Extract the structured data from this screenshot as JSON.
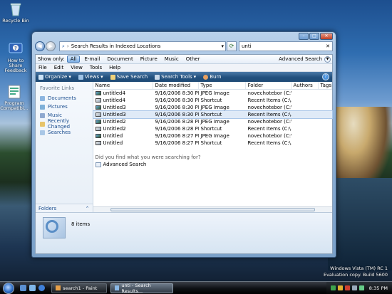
{
  "desktop": {
    "icons": [
      {
        "label": "Recycle Bin"
      },
      {
        "label": "How to Share Feedback"
      },
      {
        "label": "Program Compatibi..."
      }
    ],
    "watermark_line1": "Windows Vista (TM) RC 1",
    "watermark_line2": "Evaluation copy. Build 5600"
  },
  "window": {
    "address": "Search Results in Indexed Locations",
    "search_value": "unti",
    "show_only": {
      "label": "Show only:",
      "items": [
        "All",
        "E-mail",
        "Document",
        "Picture",
        "Music",
        "Other"
      ],
      "active": "All",
      "advanced": "Advanced Search"
    },
    "menu": [
      "File",
      "Edit",
      "View",
      "Tools",
      "Help"
    ],
    "toolbar": {
      "organize": "Organize",
      "views": "Views",
      "save_search": "Save Search",
      "search_tools": "Search Tools",
      "burn": "Burn"
    },
    "sidebar": {
      "heading": "Favorite Links",
      "links": [
        "Documents",
        "Pictures",
        "Music",
        "Recently Changed",
        "Searches"
      ],
      "folders_label": "Folders"
    },
    "columns": [
      "Name",
      "Date modified",
      "Type",
      "Folder",
      "Authors",
      "Tags"
    ],
    "rows": [
      {
        "name": "untitled4",
        "date": "9/16/2006 8:30 PM",
        "type": "JPEG Image",
        "folder": "novechotebor (C:\\...",
        "icon": "jpg"
      },
      {
        "name": "untitled4",
        "date": "9/16/2006 8:30 PM",
        "type": "Shortcut",
        "folder": "Recent Items (C:\\...",
        "icon": "sc"
      },
      {
        "name": "Untitled3",
        "date": "9/16/2006 8:30 PM",
        "type": "JPEG Image",
        "folder": "novechotebor (C:\\...",
        "icon": "jpg"
      },
      {
        "name": "Untitled3",
        "date": "9/16/2006 8:30 PM",
        "type": "Shortcut",
        "folder": "Recent Items (C:\\...",
        "icon": "sc"
      },
      {
        "name": "Untitled2",
        "date": "9/16/2006 8:28 PM",
        "type": "JPEG Image",
        "folder": "novechotebor (C:\\...",
        "icon": "jpg"
      },
      {
        "name": "Untitled2",
        "date": "9/16/2006 8:28 PM",
        "type": "Shortcut",
        "folder": "Recent Items (C:\\...",
        "icon": "sc"
      },
      {
        "name": "Untitled",
        "date": "9/16/2006 8:27 PM",
        "type": "JPEG Image",
        "folder": "novechotebor (C:\\...",
        "icon": "jpg"
      },
      {
        "name": "Untitled",
        "date": "9/16/2006 8:27 PM",
        "type": "Shortcut",
        "folder": "Recent Items (C:\\...",
        "icon": "sc"
      }
    ],
    "selected_row": 3,
    "not_found": "Did you find what you were searching for?",
    "advanced_search_link": "Advanced Search",
    "details_count": "8 items"
  },
  "taskbar": {
    "tasks": [
      {
        "label": "search1 - Paint",
        "active": false
      },
      {
        "label": "unti - Search Results...",
        "active": true
      }
    ],
    "clock": "8:35 PM"
  }
}
